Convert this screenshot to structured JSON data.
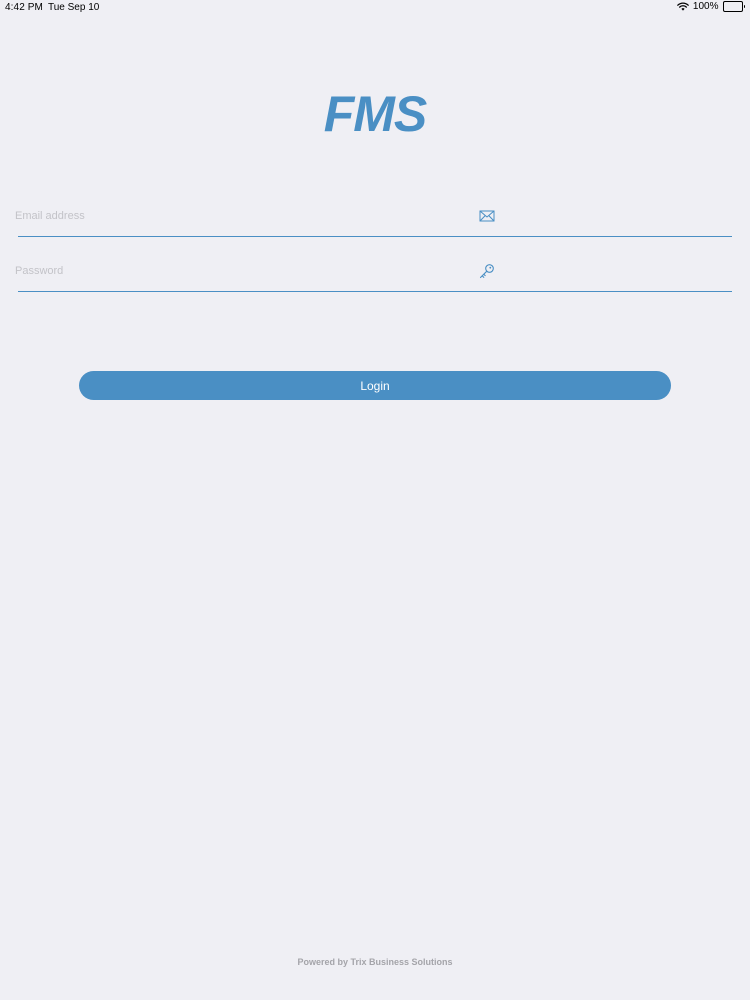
{
  "status_bar": {
    "time": "4:42 PM",
    "date": "Tue Sep 10",
    "battery": "100%",
    "icons": [
      "wifi-icon",
      "battery-icon"
    ]
  },
  "app": {
    "title": "FMS"
  },
  "form": {
    "email": {
      "value": "",
      "placeholder": "Email address",
      "icon": "envelope-icon"
    },
    "password": {
      "value": "",
      "placeholder": "Password",
      "icon": "key-icon"
    },
    "login_label": "Login"
  },
  "footer": {
    "text": "Powered by Trix Business Solutions"
  },
  "colors": {
    "background": "#efeff4",
    "accent": "#4a8fc4",
    "button_text": "#ffffff",
    "placeholder": "#c3c3c8",
    "footer_text": "#a4a4a9"
  }
}
